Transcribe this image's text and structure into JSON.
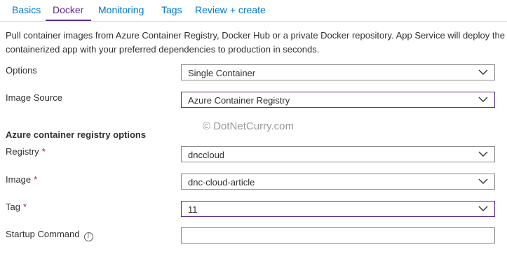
{
  "tabs": [
    "Basics",
    "Docker",
    "Monitoring",
    "Tags",
    "Review + create"
  ],
  "active_tab": "Docker",
  "colors": {
    "link": "#0078d4",
    "active": "#5c2d91",
    "required": "#a4262c",
    "border": "#8a8886"
  },
  "description": "Pull container images from Azure Container Registry, Docker Hub or a private Docker repository. App Service will deploy the containerized app with your preferred dependencies to production in seconds.",
  "fields": {
    "options": {
      "label": "Options",
      "value": "Single Container"
    },
    "image_source": {
      "label": "Image Source",
      "value": "Azure Container Registry"
    },
    "section_title": "Azure container registry options",
    "registry": {
      "label": "Registry",
      "required_mark": "*",
      "value": "dnccloud"
    },
    "image": {
      "label": "Image",
      "required_mark": "*",
      "value": "dnc-cloud-article"
    },
    "tag": {
      "label": "Tag",
      "required_mark": "*",
      "value": "11"
    },
    "startup_command": {
      "label": "Startup Command",
      "value": "",
      "info_icon": "i"
    }
  },
  "watermark": "© DotNetCurry.com",
  "icons": {
    "dropdown": "chevron-down-icon",
    "info": "info-icon"
  }
}
